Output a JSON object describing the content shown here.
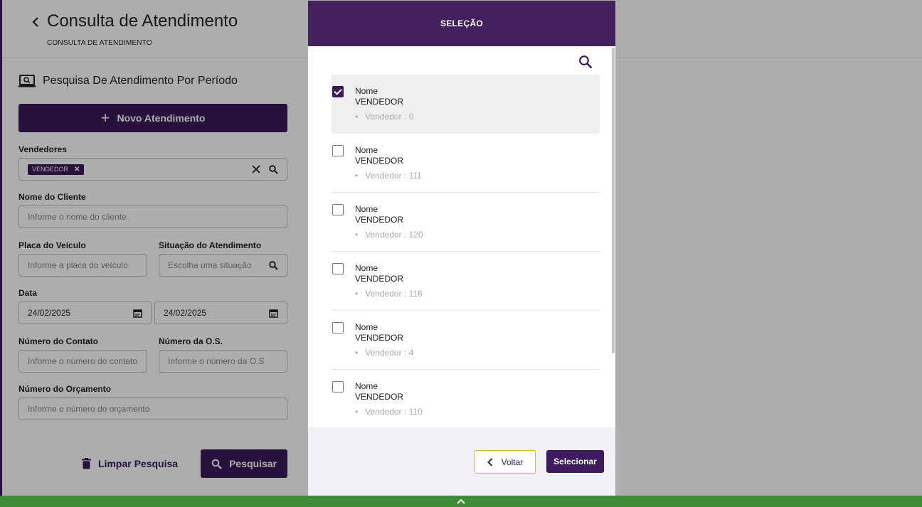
{
  "page": {
    "title": "Consulta de Atendimento",
    "subtitle": "CONSULTA DE ATENDIMENTO",
    "back_icon": "chevron-left-icon",
    "section_title": "Pesquisa De Atendimento Por Período",
    "new_button": "Novo Atendimento",
    "fields": {
      "vendedores": {
        "label": "Vendedores",
        "chip": "VENDEDOR"
      },
      "nome_cliente": {
        "label": "Nome do Cliente",
        "placeholder": "Informe o nome do cliente"
      },
      "placa": {
        "label": "Placa do Veículo",
        "placeholder": "Informe a placa do veículo"
      },
      "situacao": {
        "label": "Situação do Atendimento",
        "placeholder": "Escolha uma situação"
      },
      "data": {
        "label": "Data",
        "start": "24/02/2025",
        "end": "24/02/2025"
      },
      "numero_contato": {
        "label": "Número do Contato",
        "placeholder": "Informe o número do contato"
      },
      "numero_os": {
        "label": "Número da O.S.",
        "placeholder": "Informe o número da O.S"
      },
      "numero_orcamento": {
        "label": "Número do Orçamento",
        "placeholder": "Informe o número do orçamento"
      }
    },
    "clear_button": "Limpar Pesquisa",
    "search_button": "Pesquisar"
  },
  "modal": {
    "title": "SELEÇÃO",
    "items": [
      {
        "name": "Nome",
        "role": "VENDEDOR",
        "code": "Vendedor : 0",
        "checked": true
      },
      {
        "name": "Nome",
        "role": "VENDEDOR",
        "code": "Vendedor : 111",
        "checked": false
      },
      {
        "name": "Nome",
        "role": "VENDEDOR",
        "code": "Vendedor : 120",
        "checked": false
      },
      {
        "name": "Nome",
        "role": "VENDEDOR",
        "code": "Vendedor : 116",
        "checked": false
      },
      {
        "name": "Nome",
        "role": "VENDEDOR",
        "code": "Vendedor : 4",
        "checked": false
      },
      {
        "name": "Nome",
        "role": "VENDEDOR",
        "code": "Vendedor : 110",
        "checked": false
      }
    ],
    "back_button": "Voltar",
    "select_button": "Selecionar"
  },
  "colors": {
    "primary": "#3d1a5b",
    "header": "#45205f",
    "bottom_bar": "#3f8c38",
    "back_border": "#e3b444"
  }
}
